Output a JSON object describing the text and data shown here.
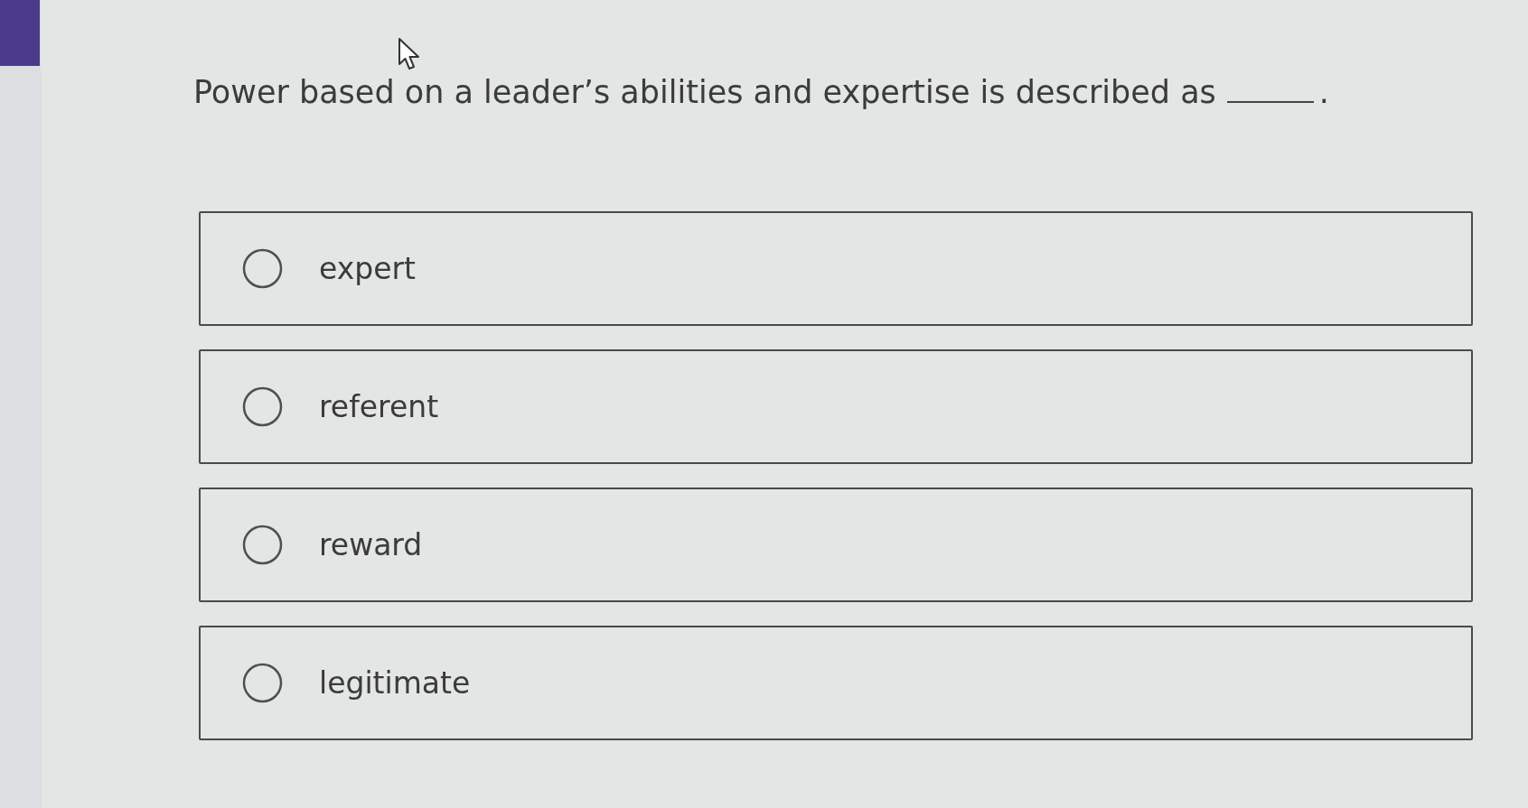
{
  "question": {
    "parts": [
      {
        "kind": "text",
        "text": "Power based on a leader’s abilities and expertise is described as"
      },
      {
        "kind": "blank"
      },
      {
        "kind": "text",
        "text": "."
      }
    ]
  },
  "options": [
    {
      "label": "expert",
      "selected": false
    },
    {
      "label": "referent",
      "selected": false
    },
    {
      "label": "reward",
      "selected": false
    },
    {
      "label": "legitimate",
      "selected": false
    }
  ]
}
